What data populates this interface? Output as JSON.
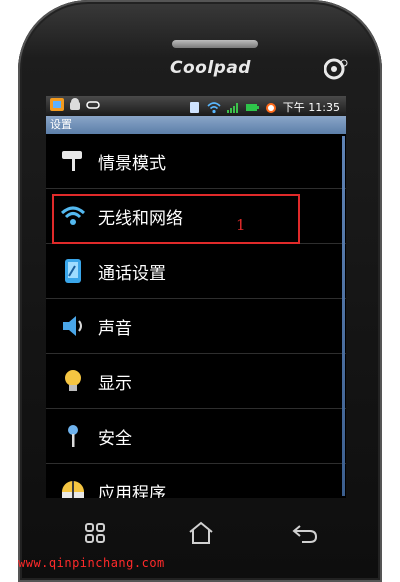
{
  "device": {
    "brand": "Coolpad",
    "operator_logo": "operator-logo-icon"
  },
  "status_bar": {
    "time": "下午 11:35",
    "left_icons": [
      "app-icon",
      "android-icon",
      "voicemail-icon"
    ],
    "right_icons": [
      "sim-icon",
      "wifi-icon",
      "signal-icon",
      "battery-icon",
      "alarm-icon"
    ]
  },
  "screen": {
    "title": "设置",
    "menu": [
      {
        "label": "情景模式",
        "icon": "roller-icon"
      },
      {
        "label": "无线和网络",
        "icon": "wifi-icon"
      },
      {
        "label": "通话设置",
        "icon": "phone-settings-icon"
      },
      {
        "label": "声音",
        "icon": "speaker-icon"
      },
      {
        "label": "显示",
        "icon": "bulb-icon"
      },
      {
        "label": "安全",
        "icon": "pin-icon"
      },
      {
        "label": "应用程序",
        "icon": "apps-icon"
      }
    ]
  },
  "annotation": {
    "number": "1",
    "highlighted_item": "无线和网络",
    "color": "#e02a2a"
  },
  "hardware_keys": [
    "menu-icon",
    "home-icon",
    "back-icon"
  ],
  "watermark": "www.qinpinchang.com",
  "colors": {
    "titlebar": "#6f8fb8",
    "highlight": "#e02a2a",
    "watermark": "#ff2a2a"
  }
}
